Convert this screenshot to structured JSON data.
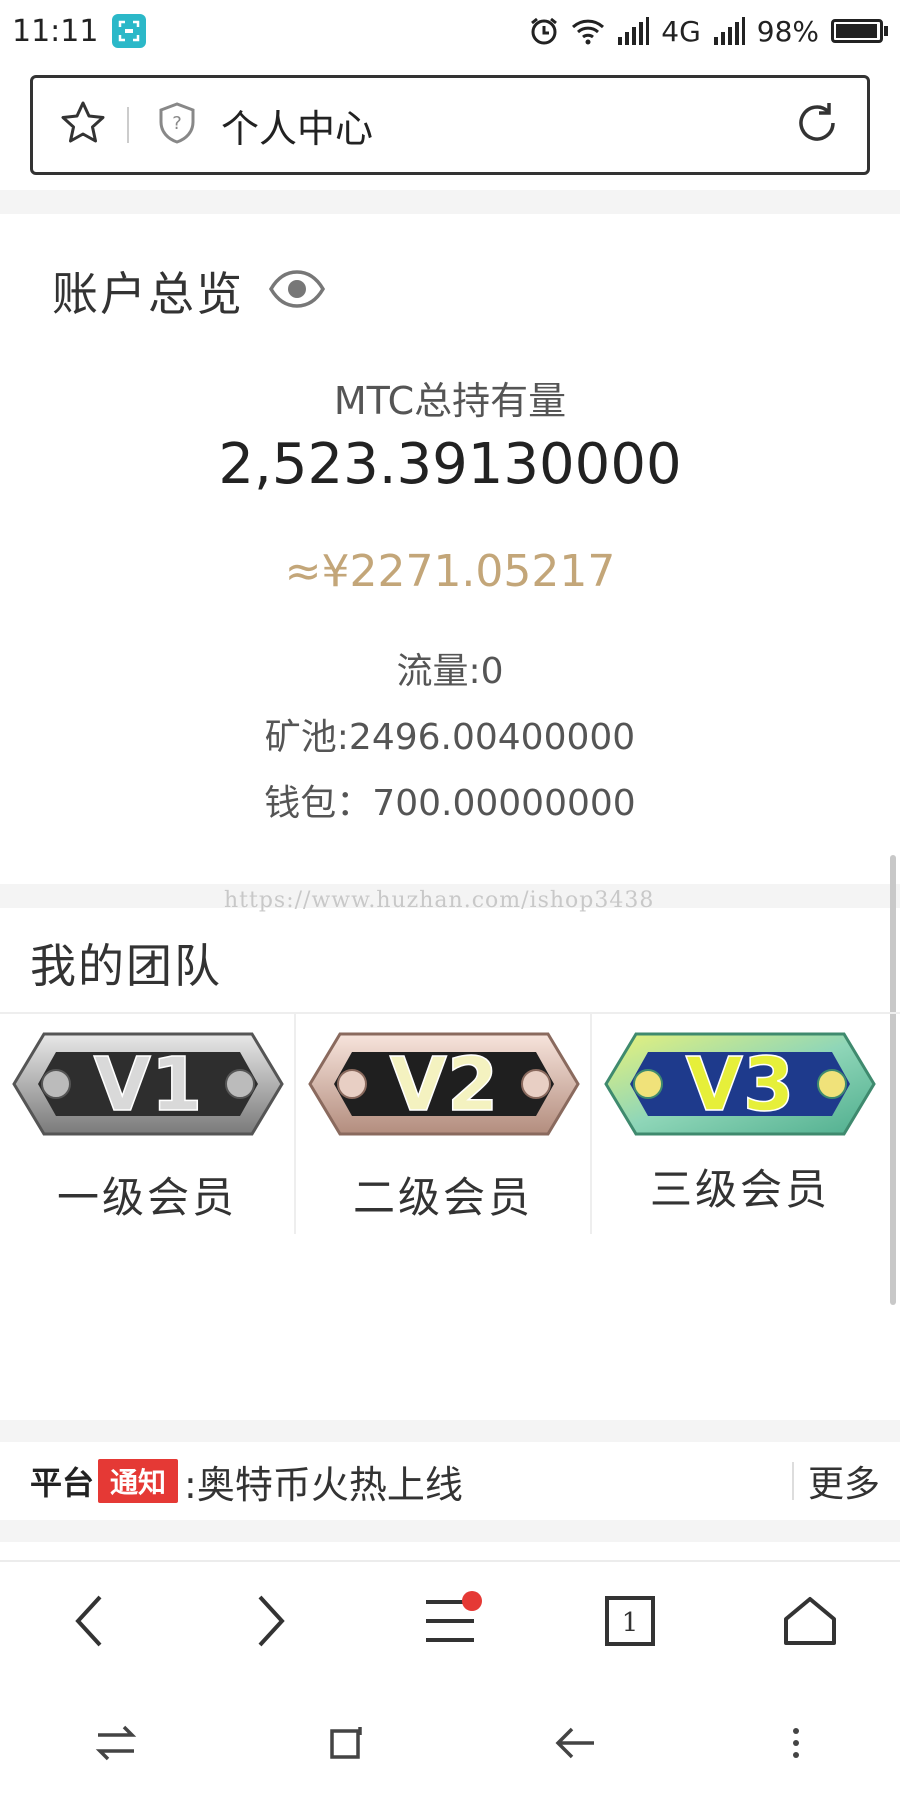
{
  "status_bar": {
    "time": "11:11",
    "network": "4G",
    "battery": "98%",
    "battery_level": 0.98
  },
  "browser": {
    "page_title": "个人中心"
  },
  "overview": {
    "title": "账户总览",
    "holding_label": "MTC总持有量",
    "holding_value": "2,523.39130000",
    "cny_value": "≈¥2271.05217",
    "flow": "流量:0",
    "pool": "矿池:2496.00400000",
    "wallet": "钱包：700.00000000"
  },
  "watermark": "https://www.huzhan.com/ishop3438",
  "team": {
    "title": "我的团队",
    "levels": [
      {
        "badge": "V1",
        "name": "一级会员"
      },
      {
        "badge": "V2",
        "name": "二级会员"
      },
      {
        "badge": "V3",
        "name": "三级会员"
      }
    ]
  },
  "notice": {
    "tag_a": "平台",
    "tag_b": "通知",
    "text": ":奥特币火热上线",
    "more": "更多"
  },
  "bottom_nav": {
    "tabs_count": "1"
  },
  "colors": {
    "accent_gold": "#c3a679",
    "notice_red": "#e53935",
    "status_icon_teal": "#2bb8c8"
  }
}
